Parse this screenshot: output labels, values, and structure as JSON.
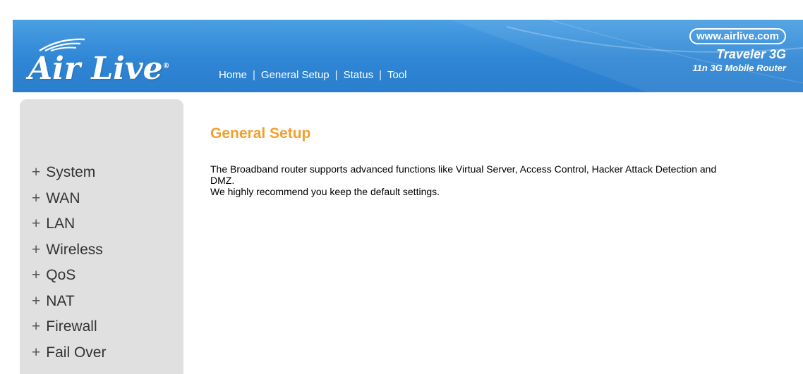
{
  "brand": {
    "logo_text": "Air Live",
    "logo_reg": "®",
    "url": "www.airlive.com",
    "product_name": "Traveler 3G",
    "product_subtitle": "11n 3G Mobile Router"
  },
  "topnav": {
    "items": [
      "Home",
      "General Setup",
      "Status",
      "Tool"
    ],
    "separator": "|"
  },
  "sidebar": {
    "items": [
      {
        "label": "System"
      },
      {
        "label": "WAN"
      },
      {
        "label": "LAN"
      },
      {
        "label": "Wireless"
      },
      {
        "label": "QoS"
      },
      {
        "label": "NAT"
      },
      {
        "label": "Firewall"
      },
      {
        "label": "Fail Over"
      }
    ],
    "prefix": "+"
  },
  "main": {
    "title": "General Setup",
    "paragraph1": "The Broadband router supports advanced functions like Virtual Server, Access Control, Hacker Attack Detection and DMZ.",
    "paragraph2": "We highly recommend you keep the default settings."
  },
  "colors": {
    "header_blue": "#2f86d4",
    "title_orange": "#f0a030",
    "sidebar_gray": "#e0e0e0"
  }
}
